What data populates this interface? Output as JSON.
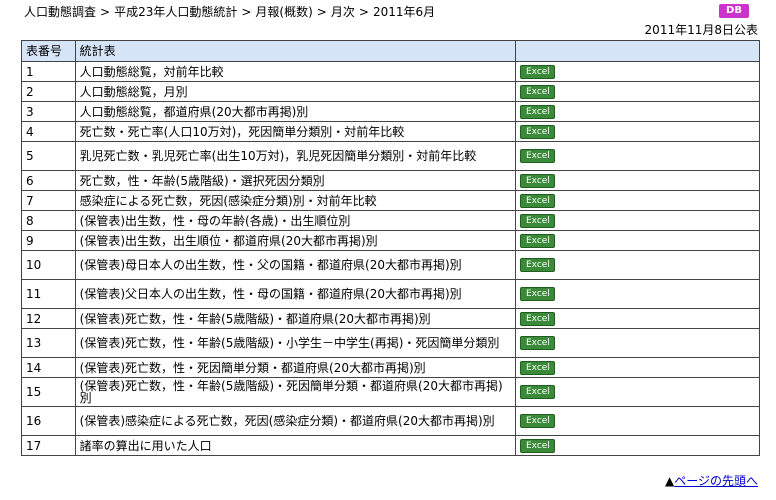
{
  "breadcrumb": {
    "items": [
      "人口動態調査",
      "平成23年人口動態統計",
      "月報(概数)",
      "月次",
      "2011年6月"
    ],
    "separator": ">"
  },
  "db_badge": "DB",
  "publish_date": "2011年11月8日公表",
  "table": {
    "headers": [
      "表番号",
      "統計表",
      ""
    ],
    "download_label": "Excel",
    "rows": [
      {
        "no": "1",
        "name": "人口動態総覧，対前年比較"
      },
      {
        "no": "2",
        "name": "人口動態総覧，月別"
      },
      {
        "no": "3",
        "name": "人口動態総覧，都道府県(20大都市再掲)別"
      },
      {
        "no": "4",
        "name": "死亡数・死亡率(人口10万対)，死因簡単分類別・対前年比較"
      },
      {
        "no": "5",
        "name": "乳児死亡数・乳児死亡率(出生10万対)，乳児死因簡単分類別・対前年比較"
      },
      {
        "no": "6",
        "name": "死亡数，性・年齢(5歳階級)・選択死因分類別"
      },
      {
        "no": "7",
        "name": "感染症による死亡数，死因(感染症分類)別・対前年比較"
      },
      {
        "no": "8",
        "name": "(保管表)出生数，性・母の年齢(各歳)・出生順位別"
      },
      {
        "no": "9",
        "name": "(保管表)出生数，出生順位・都道府県(20大都市再掲)別"
      },
      {
        "no": "10",
        "name": "(保管表)母日本人の出生数，性・父の国籍・都道府県(20大都市再掲)別"
      },
      {
        "no": "11",
        "name": "(保管表)父日本人の出生数，性・母の国籍・都道府県(20大都市再掲)別"
      },
      {
        "no": "12",
        "name": "(保管表)死亡数，性・年齢(5歳階級)・都道府県(20大都市再掲)別"
      },
      {
        "no": "13",
        "name": "(保管表)死亡数，性・年齢(5歳階級)・小学生－中学生(再掲)・死因簡単分類別"
      },
      {
        "no": "14",
        "name": "(保管表)死亡数，性・死因簡単分類・都道府県(20大都市再掲)別"
      },
      {
        "no": "15",
        "name": "(保管表)死亡数，性・年齢(5歳階級)・死因簡単分類・都道府県(20大都市再掲)別"
      },
      {
        "no": "16",
        "name": "(保管表)感染症による死亡数，死因(感染症分類)・都道府県(20大都市再掲)別"
      },
      {
        "no": "17",
        "name": "諸率の算出に用いた人口"
      }
    ]
  },
  "page_top": {
    "marker": "▲",
    "label": "ページの先頭へ"
  },
  "colors": {
    "header_bg": "#d6e4f7",
    "excel_bg": "#3a8a3a",
    "db_badge_bg": "#cc33cc",
    "link": "#0000cc"
  }
}
